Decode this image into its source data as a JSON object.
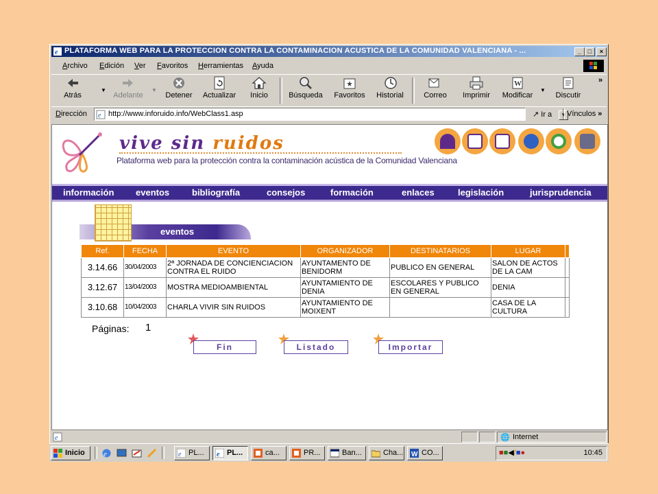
{
  "window": {
    "title": "PLATAFORMA WEB PARA LA PROTECCION CONTRA LA CONTAMINACION ACUSTICA DE LA COMUNIDAD VALENCIANA - ...",
    "controls": [
      "_",
      "□",
      "×"
    ]
  },
  "menu": [
    "Archivo",
    "Edición",
    "Ver",
    "Favoritos",
    "Herramientas",
    "Ayuda"
  ],
  "toolbar": [
    {
      "label": "Atrás",
      "icon": "back-arrow-icon",
      "disabled": false
    },
    {
      "label": "Adelante",
      "icon": "forward-arrow-icon",
      "disabled": true
    },
    {
      "label": "Detener",
      "icon": "stop-icon",
      "disabled": false
    },
    {
      "label": "Actualizar",
      "icon": "refresh-icon",
      "disabled": false
    },
    {
      "label": "Inicio",
      "icon": "home-icon",
      "disabled": false
    },
    {
      "label": "Búsqueda",
      "icon": "search-icon",
      "disabled": false
    },
    {
      "label": "Favoritos",
      "icon": "favorites-icon",
      "disabled": false
    },
    {
      "label": "Historial",
      "icon": "history-icon",
      "disabled": false
    },
    {
      "label": "Correo",
      "icon": "mail-icon",
      "disabled": false
    },
    {
      "label": "Imprimir",
      "icon": "print-icon",
      "disabled": false
    },
    {
      "label": "Modificar",
      "icon": "edit-icon",
      "disabled": false
    },
    {
      "label": "Discutir",
      "icon": "discuss-icon",
      "disabled": false
    }
  ],
  "address": {
    "label": "Dirección",
    "url": "http://www.inforuido.info/WebClass1.asp",
    "go": "Ir a",
    "links": "Vínculos"
  },
  "site": {
    "logo_text": [
      "vive",
      "sin",
      "ruidos"
    ],
    "subtitle": "Plataforma web para la protección contra la contaminación acústica de la Comunidad Valenciana",
    "nav": [
      "información",
      "eventos",
      "bibliografía",
      "consejos",
      "formación",
      "enlaces",
      "legislación",
      "jurisprudencia"
    ],
    "section_title": "eventos",
    "table": {
      "headers": [
        "Ref.",
        "FECHA",
        "EVENTO",
        "ORGANIZADOR",
        "DESTINATARIOS",
        "LUGAR"
      ],
      "rows": [
        {
          "ref": "3.14.66",
          "fecha": "30/04/2003",
          "evento": "2ª JORNADA DE CONCIENCIACION CONTRA EL RUIDO",
          "organizador": "AYUNTAMENTO DE BENIDORM",
          "destinatarios": "PUBLICO EN GENERAL",
          "lugar": "SALON DE ACTOS DE LA CAM"
        },
        {
          "ref": "3.12.67",
          "fecha": "13/04/2003",
          "evento": "MOSTRA MEDIOAMBIENTAL",
          "organizador": "AYUNTAMIENTO DE DENIA",
          "destinatarios": "ESCOLARES Y PUBLICO EN GENERAL",
          "lugar": "DENIA"
        },
        {
          "ref": "3.10.68",
          "fecha": "10/04/2003",
          "evento": "CHARLA VIVIR SIN RUIDOS",
          "organizador": "AYUNTAMIENTO DE MOIXENT",
          "destinatarios": "",
          "lugar": "CASA DE LA CULTURA"
        }
      ]
    },
    "pagination": {
      "label": "Páginas:",
      "page": "1"
    },
    "buttons": [
      "Fin",
      "Listado",
      "Importar"
    ]
  },
  "status": {
    "zone": "Internet"
  },
  "taskbar": {
    "start": "Inicio",
    "tasks": [
      {
        "label": "PL...",
        "pressed": false
      },
      {
        "label": "PL...",
        "pressed": true
      },
      {
        "label": "ca...",
        "pressed": false
      },
      {
        "label": "PR...",
        "pressed": false
      },
      {
        "label": "Ban...",
        "pressed": false
      },
      {
        "label": "Cha...",
        "pressed": false
      },
      {
        "label": "CO...",
        "pressed": false
      }
    ],
    "clock": "10:45"
  },
  "colors": {
    "accent_orange": "#f0860a",
    "brand_purple": "#3d2a8e",
    "desktop": "#fbcc99"
  }
}
